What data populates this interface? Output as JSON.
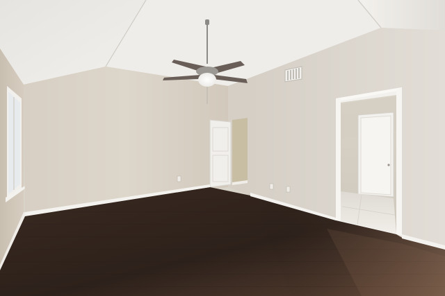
{
  "scene": {
    "description_free": true,
    "colors": {
      "ceiling": "#e9e7e3",
      "wall_left": "#d8d0c4",
      "wall_back": "#d9d2c8",
      "wall_right": "#dcd6ce",
      "floor_dark": "#2b1f1a",
      "floor_light": "#5c4233",
      "trim": "#f4f2ee",
      "door": "#f1efeb",
      "tile": "#e6e3de",
      "fan_metal": "#8c8a87",
      "fan_blade": "#6a5f58"
    },
    "objects": [
      "ceiling-fan",
      "air-vent",
      "window",
      "interior-door",
      "open-doorway",
      "hardwood-floor",
      "baseboard",
      "electrical-outlet"
    ]
  }
}
